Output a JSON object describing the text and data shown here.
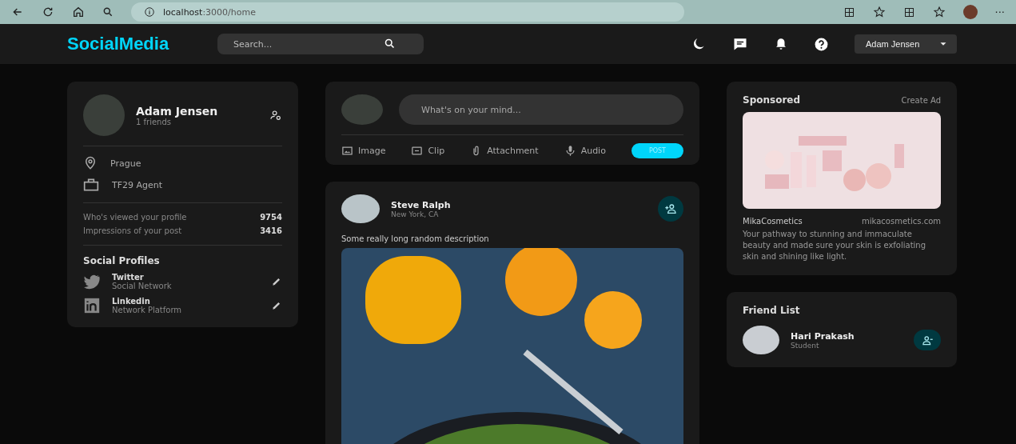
{
  "browser": {
    "url_host": "localhost",
    "url_path": ":3000/home",
    "more": "···"
  },
  "navbar": {
    "logo": "SocialMedia",
    "search": {
      "placeholder": "Search..."
    },
    "user": "Adam Jensen"
  },
  "profile": {
    "name": "Adam Jensen",
    "friends": "1 friends",
    "location": "Prague",
    "occupation": "TF29 Agent",
    "stats": [
      {
        "label": "Who's viewed your profile",
        "value": "9754"
      },
      {
        "label": "Impressions of your post",
        "value": "3416"
      }
    ],
    "social_title": "Social Profiles",
    "socials": [
      {
        "kind": "twitter",
        "name": "Twitter",
        "subtitle": "Social Network"
      },
      {
        "kind": "linkedin",
        "name": "Linkedin",
        "subtitle": "Network Platform"
      }
    ]
  },
  "composer": {
    "placeholder": "What's on your mind...",
    "actions": [
      {
        "kind": "image",
        "label": "Image"
      },
      {
        "kind": "clip",
        "label": "Clip"
      },
      {
        "kind": "attachment",
        "label": "Attachment"
      },
      {
        "kind": "audio",
        "label": "Audio"
      }
    ],
    "post_button": "POST",
    "post_disabled": true
  },
  "post": {
    "author": "Steve Ralph",
    "location": "New York, CA",
    "description": "Some really long random description"
  },
  "sponsored": {
    "title": "Sponsored",
    "create": "Create Ad",
    "brand": "MikaCosmetics",
    "website": "mikacosmetics.com",
    "text": "Your pathway to stunning and immaculate beauty and made sure your skin is exfoliating skin and shining like light."
  },
  "friends": {
    "title": "Friend List",
    "items": [
      {
        "name": "Hari Prakash",
        "subtitle": "Student"
      }
    ]
  }
}
